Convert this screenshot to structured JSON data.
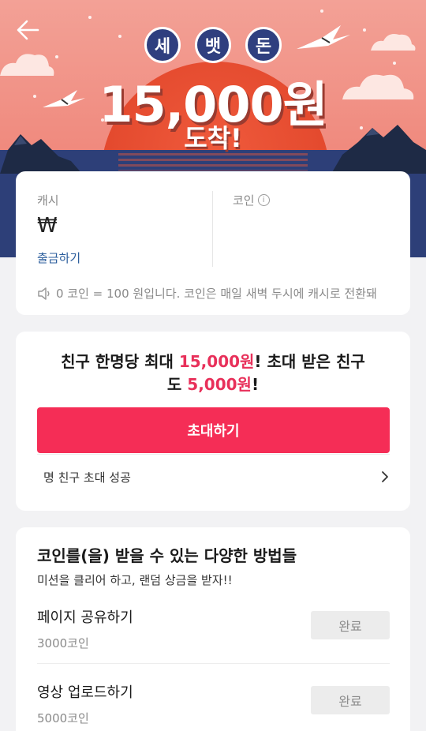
{
  "banner": {
    "badges": [
      "세",
      "뱃",
      "돈"
    ],
    "headline": "15,000원",
    "subline": "도착!"
  },
  "balance": {
    "cash_label": "캐시",
    "cash_value": "₩",
    "withdraw_label": "출금하기",
    "coin_label": "코인",
    "notice": "0 코인 = 100 원입니다. 코인은 매일 새벽 두시에 캐시로 전환돼"
  },
  "invite": {
    "msg_part1": "친구 한명당 최대 ",
    "msg_amount1": "15,000원",
    "msg_part2": "! 초대 받은 친구",
    "msg_part3": "도 ",
    "msg_amount2": "5,000원",
    "msg_part4": "!",
    "button_label": "초대하기",
    "success_label": "명 친구 초대 성공"
  },
  "methods": {
    "title": "코인를(을) 받을 수 있는 다양한 방법들",
    "subtitle": "미션을 클리어 하고, 랜덤 상금을 받자!!",
    "missions": [
      {
        "name": "페이지 공유하기",
        "points": "3000코인",
        "status": "완료"
      },
      {
        "name": "영상 업로드하기",
        "points": "5000코인",
        "status": "완료"
      }
    ]
  },
  "colors": {
    "accent": "#f52d56",
    "accent_text": "#e8305a",
    "link": "#2b5d9c",
    "badge": "#2f3f7f",
    "sea": "#2d3f78"
  }
}
